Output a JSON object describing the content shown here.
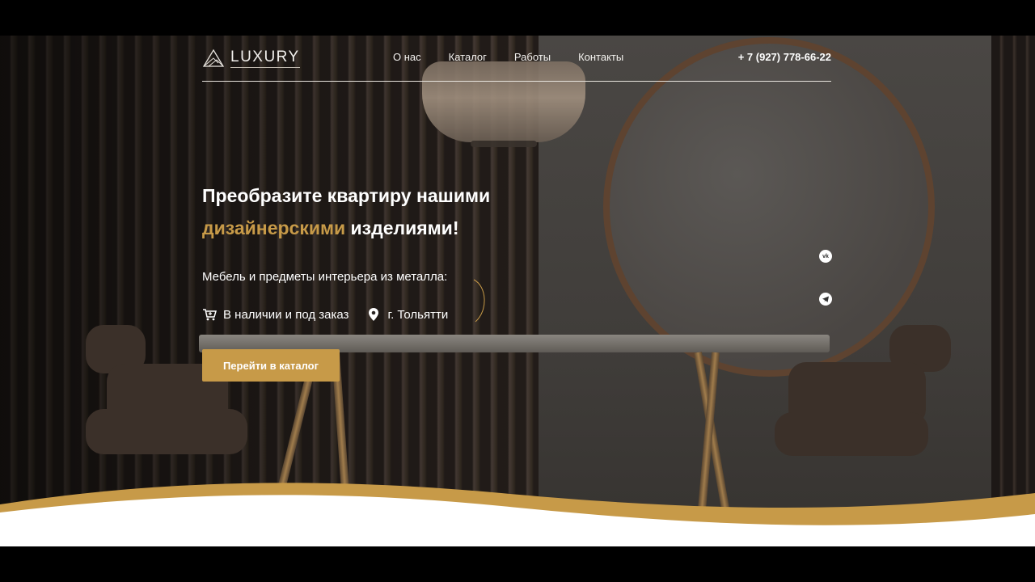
{
  "brand": {
    "name": "LUXURY"
  },
  "nav": {
    "items": [
      "О нас",
      "Каталог",
      "Работы",
      "Контакты"
    ],
    "phone": "+ 7 (927) 778-66-22"
  },
  "hero": {
    "title_line1": "Преобразите квартиру нашими",
    "title_accent": "дизайнерскими",
    "title_rest": "изделиями!",
    "subtitle": "Мебель и предметы интерьера из металла:",
    "feature_stock": "В наличии и под заказ",
    "feature_city": "г. Тольятти",
    "cta": "Перейти в каталог"
  },
  "social": {
    "vk_glyph": "vk",
    "telegram_icon": "telegram-icon"
  },
  "colors": {
    "accent": "#c79a48",
    "dark": "#2b2623",
    "white": "#ffffff"
  }
}
